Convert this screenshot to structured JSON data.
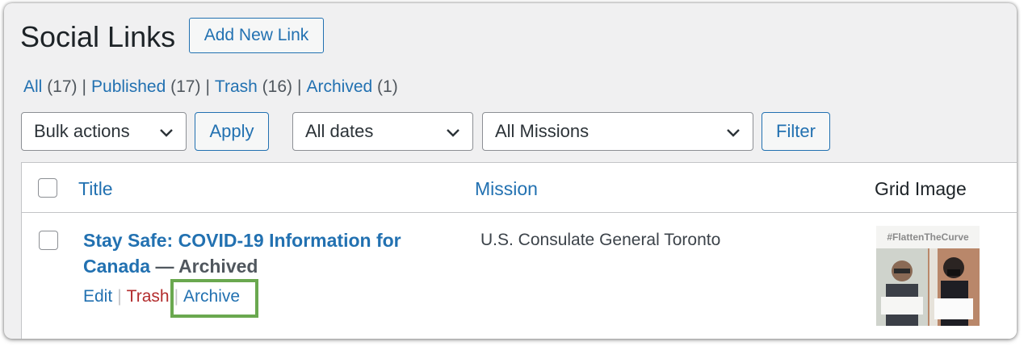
{
  "page": {
    "title": "Social Links",
    "add_new_label": "Add New Link"
  },
  "views": [
    {
      "label": "All",
      "count": "(17)"
    },
    {
      "label": "Published",
      "count": "(17)"
    },
    {
      "label": "Trash",
      "count": "(16)"
    },
    {
      "label": "Archived",
      "count": "(1)"
    }
  ],
  "filters": {
    "bulk_actions": "Bulk actions",
    "apply_label": "Apply",
    "dates": "All dates",
    "missions": "All Missions",
    "filter_label": "Filter"
  },
  "table": {
    "columns": {
      "title": "Title",
      "mission": "Mission",
      "grid_image": "Grid Image"
    },
    "rows": [
      {
        "title": "Stay Safe: COVID-19 Information for Canada",
        "state": "— Archived",
        "actions": {
          "edit": "Edit",
          "trash": "Trash",
          "archive": "Archive"
        },
        "mission": "U.S. Consulate General Toronto",
        "grid_image_caption": "#FlattenTheCurve"
      }
    ]
  },
  "colors": {
    "link": "#2271b1",
    "trash": "#b32d2e",
    "highlight": "#6aa84f"
  }
}
